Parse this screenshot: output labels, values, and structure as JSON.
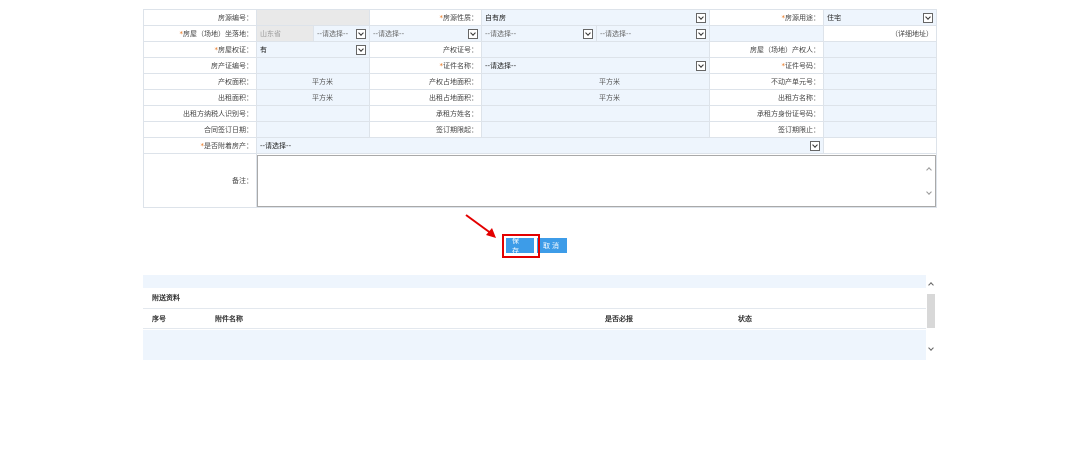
{
  "form": {
    "row1": {
      "house_no_label": "房源编号：",
      "house_no_value": "",
      "nature_label": "房源性质：",
      "nature_value": "自有房",
      "usage_label": "房源用途：",
      "usage_value": "住宅"
    },
    "row2": {
      "location_label": "房屋（场地）坐落地：",
      "province": "山东省",
      "select_placeholder": "--请选择--",
      "detail_address_hint": "（详细地址）"
    },
    "row3": {
      "ownership_label": "房屋权证：",
      "ownership_value": "有",
      "cert_no_label": "产权证号：",
      "owner_label": "房屋（场地）产权人："
    },
    "row4": {
      "house_cert_label": "房产证编号：",
      "id_type_label": "证件名称：",
      "id_type_value": "--请选择--",
      "id_no_label": "证件号码："
    },
    "row5": {
      "area_label": "产权面积：",
      "area_unit": "平方米",
      "land_area_label": "产权占地面积：",
      "land_area_unit": "平方米",
      "unit_no_label": "不动产单元号："
    },
    "row6": {
      "rent_area_label": "出租面积：",
      "rent_area_unit": "平方米",
      "rent_land_label": "出租占地面积：",
      "rent_land_unit": "平方米",
      "lessor_name_label": "出租方名称："
    },
    "row7": {
      "lessor_tax_label": "出租方纳税人识别号：",
      "lessee_name_label": "承租方姓名：",
      "lessee_id_label": "承租方身份证号码："
    },
    "row8": {
      "sign_date_label": "合同签订日期：",
      "start_label": "签订期限起：",
      "end_label": "签订期限止："
    },
    "row9": {
      "attached_label": "是否附着房产：",
      "attached_value": "--请选择--"
    },
    "notes_label": "备注："
  },
  "buttons": {
    "save": "保存",
    "cancel": "取消"
  },
  "attachments": {
    "title": "附送资料",
    "columns": {
      "no": "序号",
      "name": "附件名称",
      "required": "是否必报",
      "status": "状态"
    }
  },
  "colors": {
    "accent": "#3d9ce8",
    "required_mark": "#e8731a",
    "highlight": "#e30000"
  }
}
